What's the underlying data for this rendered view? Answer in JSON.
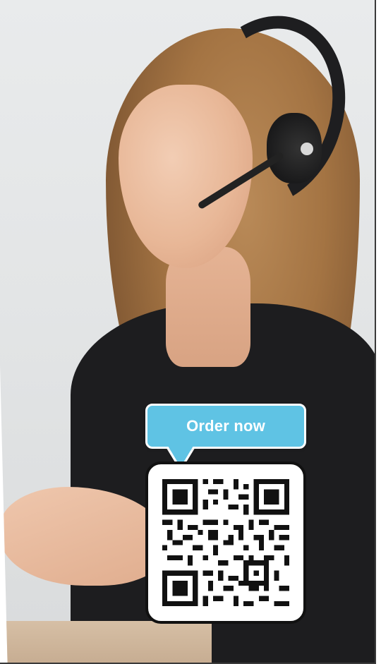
{
  "photo": {
    "subject": "woman-with-headset"
  },
  "callout": {
    "label": "Order now",
    "color": "#5fc3e4"
  },
  "qr": {
    "icon": "qr-code-icon"
  }
}
